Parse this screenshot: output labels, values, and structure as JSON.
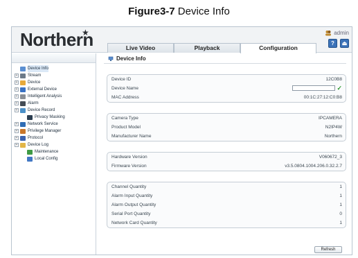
{
  "caption": {
    "label": "Figure3-7",
    "text": " Device Info"
  },
  "header": {
    "logo": "Northern",
    "logo_mark": "★",
    "user": "admin",
    "tabs": [
      {
        "label": "Live Video"
      },
      {
        "label": "Playback"
      },
      {
        "label": "Configuration"
      }
    ],
    "help_glyph": "?",
    "logout_glyph": "⏏"
  },
  "sidebar": {
    "items": [
      {
        "label": "Device Info",
        "icon": "device-info-icon",
        "color": "#5b8fd1"
      },
      {
        "label": "Stream",
        "icon": "stream-icon",
        "color": "#6c7a89"
      },
      {
        "label": "Device",
        "icon": "device-icon",
        "color": "#e7a93a"
      },
      {
        "label": "External Device",
        "icon": "external-device-icon",
        "color": "#3a72c4"
      },
      {
        "label": "Intelligent Analysis",
        "icon": "intelligent-analysis-icon",
        "color": "#8a8f96"
      },
      {
        "label": "Alarm",
        "icon": "alarm-icon",
        "color": "#444c55"
      },
      {
        "label": "Device Record",
        "icon": "device-record-icon",
        "color": "#4a90c8"
      },
      {
        "label": "Privacy Masking",
        "icon": "privacy-masking-icon",
        "color": "#2c3e50"
      },
      {
        "label": "Network Service",
        "icon": "network-service-icon",
        "color": "#2f6db5"
      },
      {
        "label": "Privilege Manager",
        "icon": "privilege-manager-icon",
        "color": "#c9772b"
      },
      {
        "label": "Protocol",
        "icon": "protocol-icon",
        "color": "#3b63b0"
      },
      {
        "label": "Device Log",
        "icon": "device-log-icon",
        "color": "#e2b648"
      },
      {
        "label": "Maintenance",
        "icon": "maintenance-icon",
        "color": "#3f9a45"
      },
      {
        "label": "Local Config",
        "icon": "local-config-icon",
        "color": "#4277c4"
      }
    ]
  },
  "main": {
    "title": "Device Info",
    "identity": [
      {
        "label": "Device ID",
        "value": "12C0B8"
      },
      {
        "label": "Device Name",
        "value": ""
      },
      {
        "label": "MAC Address",
        "value": "00:1C:27:12:C0:B8"
      }
    ],
    "model": [
      {
        "label": "Camera Type",
        "value": "IPCAMERA"
      },
      {
        "label": "Product Model",
        "value": "N2IP4W"
      },
      {
        "label": "Manufacturer Name",
        "value": "Northern"
      }
    ],
    "versions": [
      {
        "label": "Hardware Version",
        "value": "V060672_3"
      },
      {
        "label": "Firmware Version",
        "value": "v3.5.0804.1004.206.0.32.2.7"
      }
    ],
    "quantities": [
      {
        "label": "Channel Quantity",
        "value": "1"
      },
      {
        "label": "Alarm Input Quantity",
        "value": "1"
      },
      {
        "label": "Alarm Output Quantity",
        "value": "1"
      },
      {
        "label": "Serial Port Quantity",
        "value": "0"
      },
      {
        "label": "Network Card Quantity",
        "value": "1"
      }
    ],
    "refresh_label": "Refresh",
    "name_ok_glyph": "✓"
  }
}
